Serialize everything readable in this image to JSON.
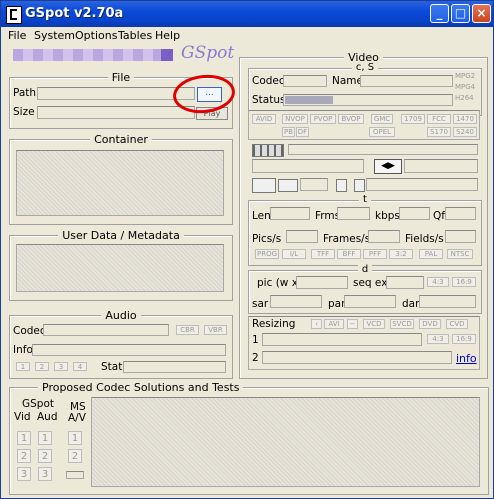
{
  "window": {
    "title": "GSpot v2.70a",
    "icon": "gspot-app-icon"
  },
  "menu": [
    "File",
    "System",
    "Options",
    "Tables",
    "Help"
  ],
  "logo": "GSpot",
  "file": {
    "title": "File",
    "path_label": "Path",
    "size_label": "Size",
    "browse_label": "...",
    "play_label": "Play"
  },
  "container": {
    "title": "Container"
  },
  "userdata": {
    "title": "User Data / Metadata"
  },
  "audio": {
    "title": "Audio",
    "codec_label": "Codec",
    "info_label": "Info",
    "stat_label": "Stat",
    "cbr": "CBR",
    "vbr": "VBR",
    "channel_buttons": [
      "1",
      "2",
      "3",
      "4"
    ]
  },
  "video": {
    "title": "Video",
    "cs_title": "c, S",
    "codec_label": "Codec",
    "name_label": "Name",
    "status_label": "Status",
    "codec_types": [
      "MPG2",
      "MPG4",
      "H264"
    ],
    "flags_row1": [
      "AVID",
      "NVOP",
      "PVOP",
      "BVOP",
      "GMC",
      "1709",
      "FCC",
      "1470"
    ],
    "flags_row2": [
      "PB",
      "DF",
      "OPEL",
      "S170",
      "S240"
    ],
    "t_title": "t",
    "len_label": "Len",
    "frms_label": "Frms",
    "kbps_label": "kbps",
    "qf_label": "Qf",
    "pics_label": "Pics/s",
    "frames_label": "Frames/s",
    "fields_label": "Fields/s",
    "flags_row3": [
      "PROG",
      "I/L",
      "TFF",
      "BFF",
      "PFF",
      "3:2",
      "PAL",
      "NTSC"
    ],
    "d_title": "d",
    "pic_label": "pic (w x",
    "seqext_label": "seq ext",
    "aspect1": "4:3",
    "aspect2": "16:9",
    "sar_label": "sar",
    "par_label": "par",
    "dar_label": "dar",
    "resizing_label": "Resizing",
    "resize_buttons": [
      "AVI",
      "VCD",
      "SVCD",
      "DVD",
      "CVD"
    ],
    "row1_label": "1",
    "row2_label": "2",
    "aspect3": "4:3",
    "aspect4": "16:9",
    "info_link": "info"
  },
  "proposed": {
    "title": "Proposed Codec Solutions and Tests",
    "gspot_label": "GSpot",
    "vid_label": "Vid",
    "aud_label": "Aud",
    "ms_label": "MS",
    "av_label": "A/V",
    "buttons": [
      "1",
      "2",
      "3"
    ]
  }
}
